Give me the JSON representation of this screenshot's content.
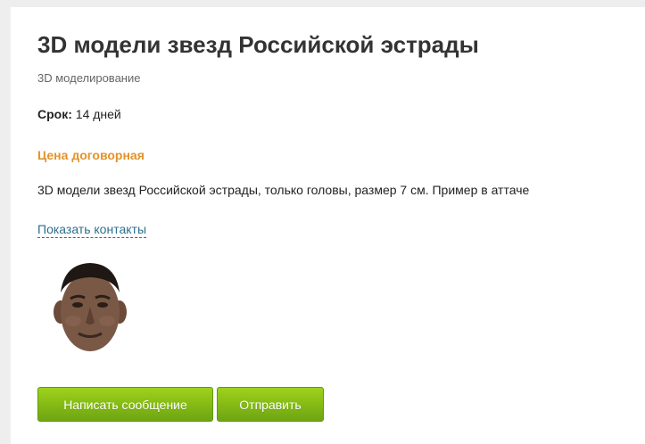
{
  "project": {
    "title": "3D модели звезд Российской эстрады",
    "category": "3D моделирование",
    "term_label": "Срок:",
    "term_value": "14 дней",
    "price": "Цена договорная",
    "description": "3D модели звезд Российской эстрады, только головы, размер 7 см. Пример в аттаче",
    "show_contacts": "Показать контакты"
  },
  "attachment": {
    "icon": "head-portrait-image"
  },
  "actions": {
    "message_label": "Написать сообщение",
    "send_label": "Отправить"
  },
  "colors": {
    "price": "#e3932a",
    "link": "#2d6f8c",
    "button_top": "#9ed21a",
    "button_bottom": "#6ea412"
  }
}
